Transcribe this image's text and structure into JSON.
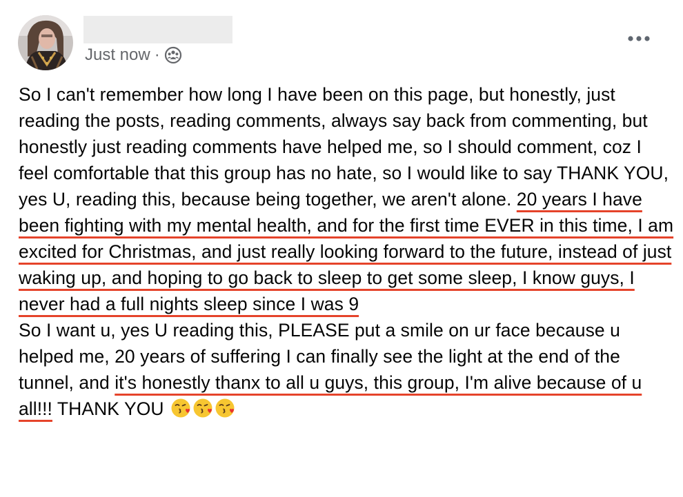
{
  "post": {
    "timestamp": "Just now",
    "separator": "·",
    "audience_icon": "group-audience-icon",
    "menu_icon": "more-horizontal-icon",
    "paragraph1": [
      {
        "text": "So I can't remember how long I have been on this page, but honestly, just reading the posts, reading comments, always say back from commenting, but honestly just reading comments have helped me, so I should comment, coz I feel comfortable that this group has no hate, so I would like to say THANK YOU, yes U, reading this, because being together, we aren't alone. ",
        "highlighted": false
      },
      {
        "text": "20 years I have been fighting with my mental health, and for the first time EVER in this time, I am excited for Christmas, and just really looking forward to the future, instead of just waking up, and hoping to go back to sleep to get some sleep, I know guys, I never had a full nights sleep since I was 9",
        "highlighted": true
      }
    ],
    "paragraph2": [
      {
        "text": "So I want u, yes U reading this, PLEASE put a smile on ur face because u helped me, 20 years of suffering I can finally see the light at the end of the tunnel, and ",
        "highlighted": false
      },
      {
        "text": "it's honestly thanx to all u guys, this group, I'm alive because of u all!!!",
        "highlighted": true
      },
      {
        "text": " THANK YOU",
        "highlighted": false
      }
    ],
    "emojis": [
      "kissing-face-with-heart-emoji",
      "kissing-face-with-heart-emoji",
      "kissing-face-with-heart-emoji"
    ],
    "highlight_color": "#e5432a",
    "meta_color": "#65676b"
  }
}
